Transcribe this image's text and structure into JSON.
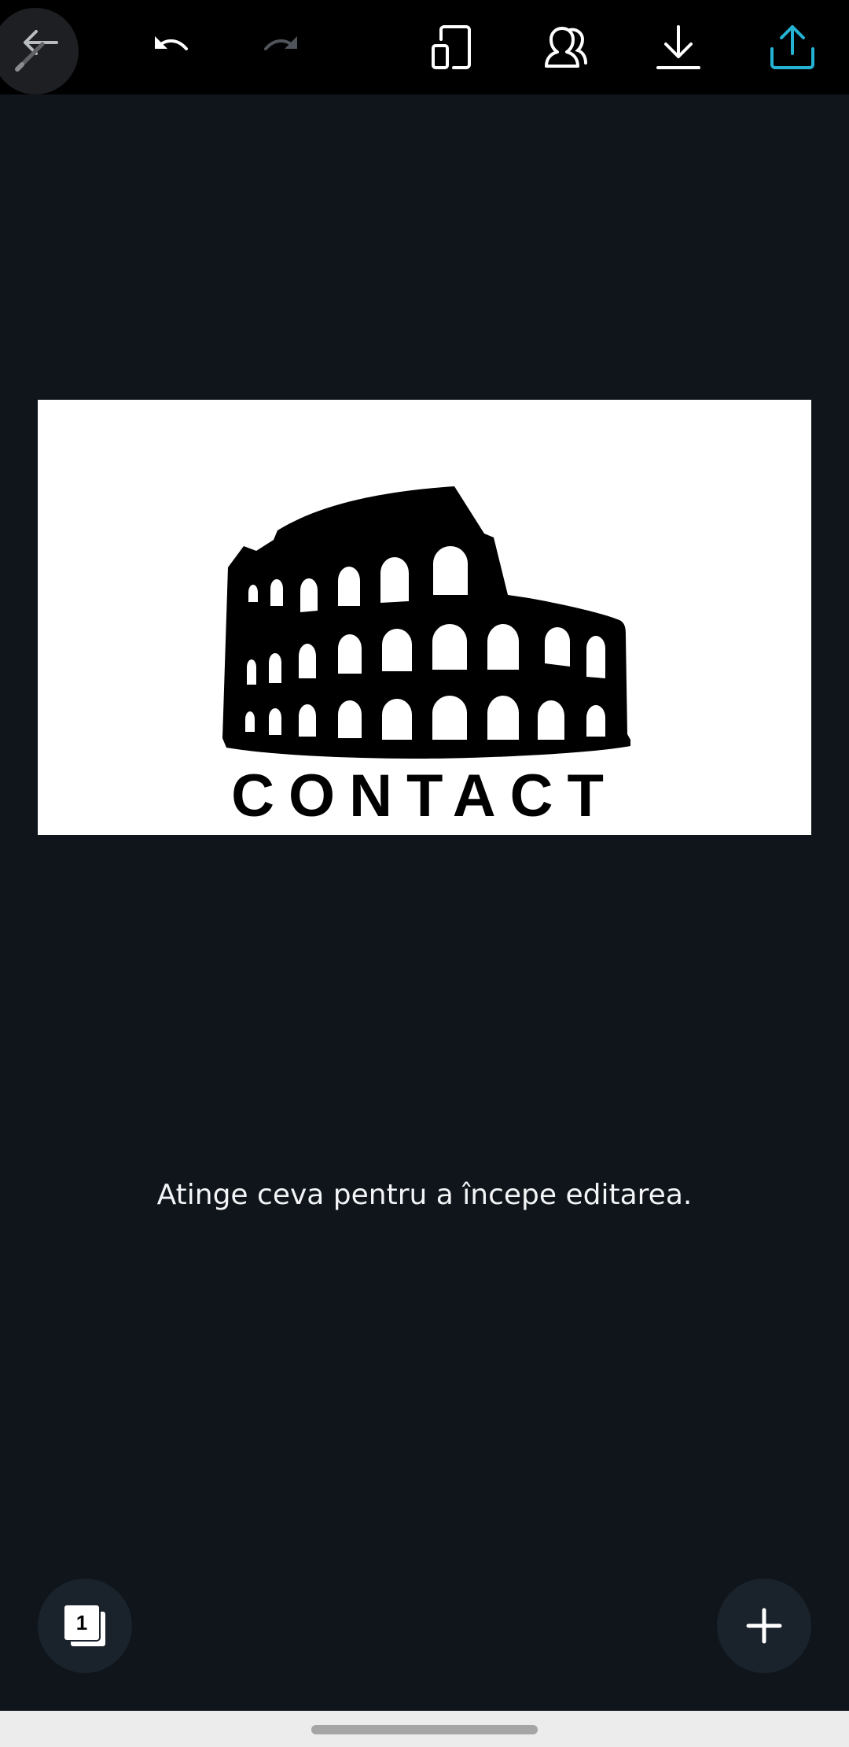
{
  "toolbar": {
    "back_icon": "arrow-left-icon",
    "undo_icon": "undo-icon",
    "redo_icon": "redo-icon",
    "resize_icon": "resize-icon",
    "share_people_icon": "people-icon",
    "download_icon": "download-icon",
    "share_icon": "share-upload-icon",
    "accent_color": "#24b3d3"
  },
  "canvas": {
    "logo_text": "CONTACT",
    "logo_icon": "colosseum-icon"
  },
  "hint_text": "Atinge ceva pentru a începe editarea.",
  "pages_button": {
    "page_number": "1"
  },
  "add_button": {
    "icon": "plus-icon"
  }
}
